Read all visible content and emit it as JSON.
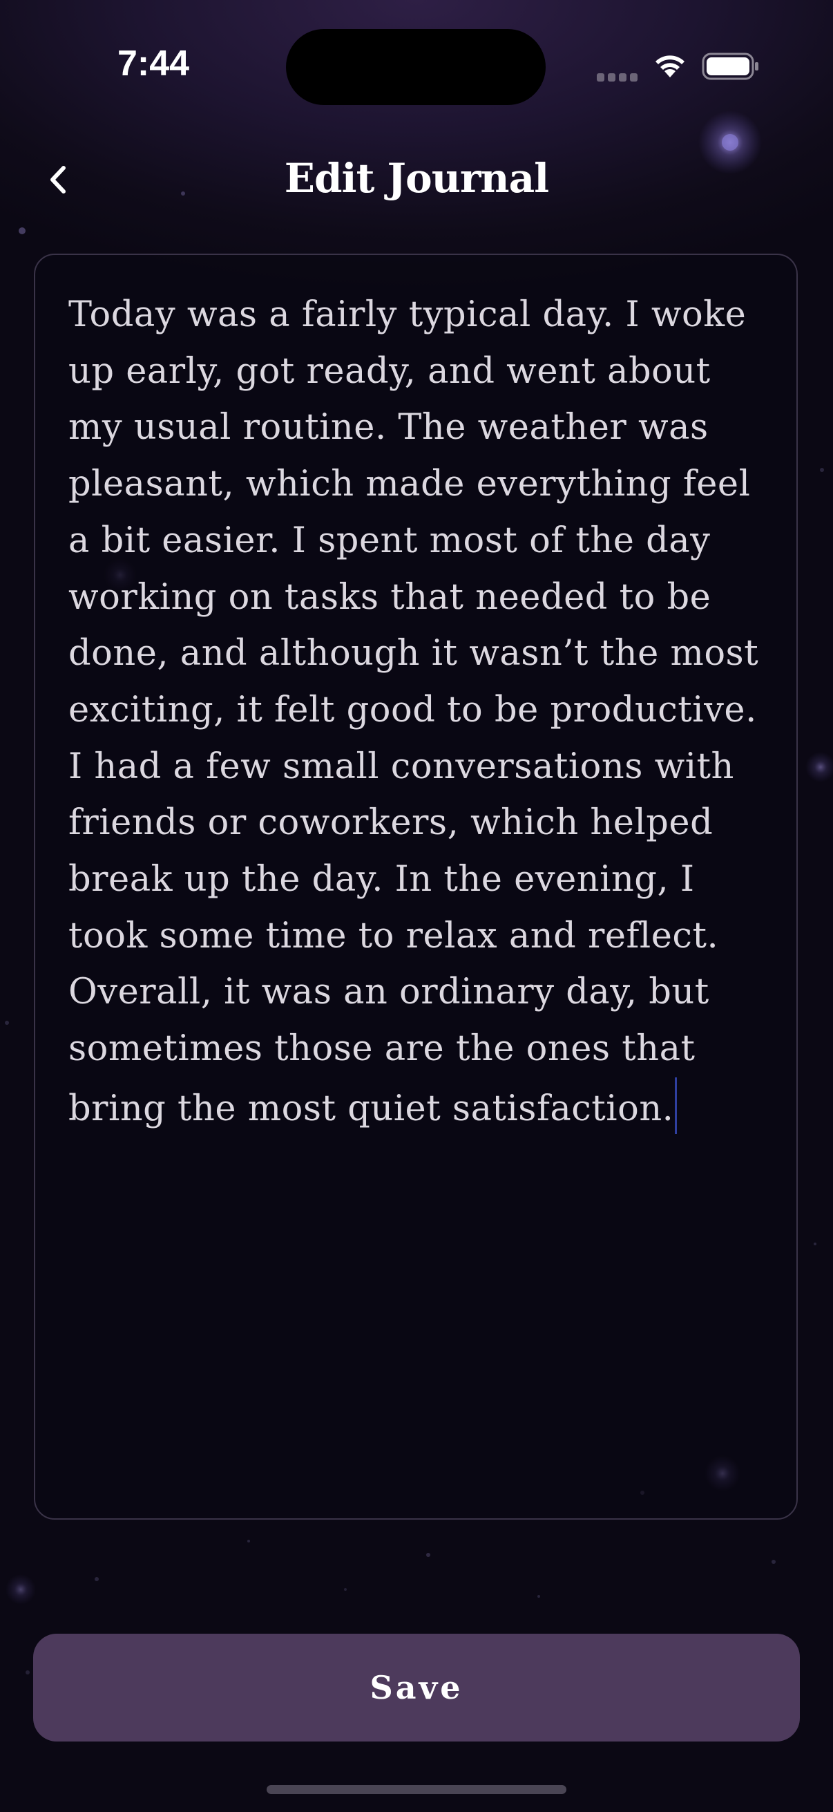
{
  "status_bar": {
    "time": "7:44"
  },
  "header": {
    "title": "Edit Journal",
    "back_icon": "chevron-left-icon"
  },
  "editor": {
    "text": "Today was a fairly typical day. I woke up early, got ready, and went about my usual routine. The weather was pleasant, which made everything feel a bit easier. I spent most of the day working on tasks that needed to be done, and although it wasn’t the most exciting, it felt good to be productive. I had a few small conversations with friends or coworkers, which helped break up the day. In the evening, I took some time to relax and reflect. Overall, it was an ordinary day, but sometimes those are the ones that bring the most quiet satisfaction."
  },
  "footer": {
    "save_label": "Save"
  },
  "colors": {
    "background": "#0f0b19",
    "accent": "#4d3a5c",
    "text": "#dcd8e0",
    "border": "#3a3348",
    "caret": "#2f3fa0"
  }
}
